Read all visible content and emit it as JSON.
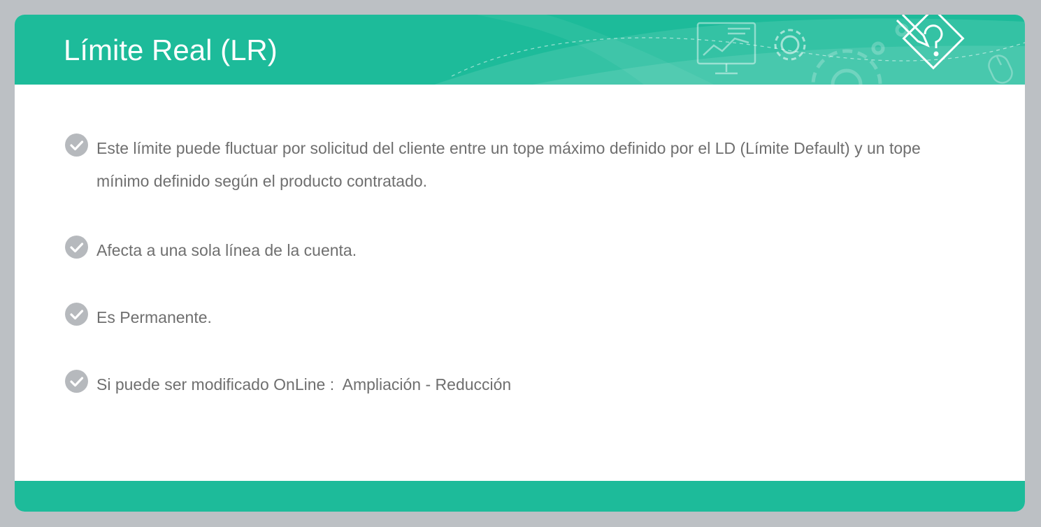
{
  "header": {
    "title": "Límite Real (LR)"
  },
  "bullets": [
    {
      "text": "Este límite puede fluctuar por solicitud del cliente entre un tope máximo definido por el LD (Límite Default) y un tope mínimo definido según el producto contratado."
    },
    {
      "text": "Afecta a una sola línea de la cuenta."
    },
    {
      "text": "Es Permanente."
    },
    {
      "text": "Si puede ser modificado OnLine :  Ampliación - Reducción"
    }
  ],
  "icons": {
    "bullet": "check-circle-icon",
    "header_decor": [
      "monitor-chart-icon",
      "gear-icon",
      "large-gear-icon",
      "pencil-question-icon",
      "mouse-icon"
    ]
  },
  "colors": {
    "accent": "#1dbb9a",
    "background": "#bcc0c4",
    "text": "#6f6f6f",
    "check": "#b6b9bd"
  }
}
